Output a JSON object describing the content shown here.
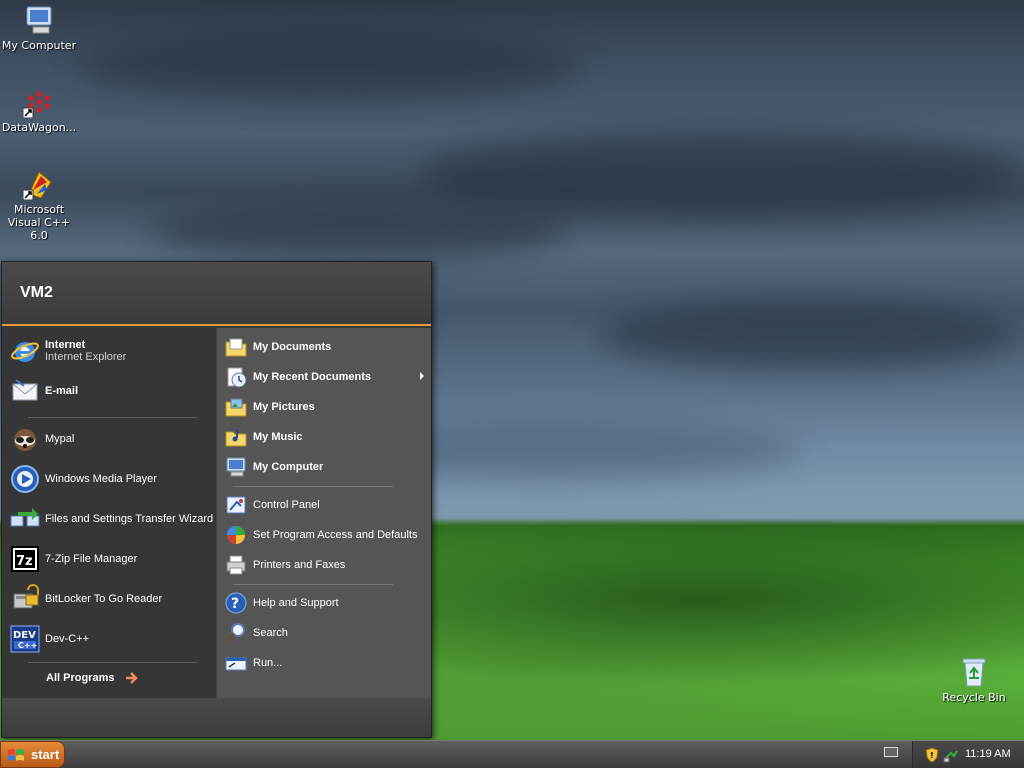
{
  "desktop": {
    "icons": [
      {
        "label": "My Computer"
      },
      {
        "label": "DataWagon..."
      },
      {
        "label": "Microsoft Visual C++ 6.0"
      },
      {
        "label": "Recycle Bin"
      }
    ]
  },
  "start_menu": {
    "user_name": "VM2",
    "pinned": [
      {
        "title": "Internet",
        "subtitle": "Internet Explorer",
        "icon": "internet-explorer-icon"
      },
      {
        "title": "E-mail",
        "icon": "email-icon"
      }
    ],
    "recent": [
      {
        "label": "Mypal",
        "icon": "mypal-icon"
      },
      {
        "label": "Windows Media Player",
        "icon": "media-player-icon"
      },
      {
        "label": "Files and Settings Transfer Wizard",
        "icon": "transfer-wizard-icon"
      },
      {
        "label": "7-Zip File Manager",
        "icon": "7zip-icon"
      },
      {
        "label": "BitLocker To Go Reader",
        "icon": "bitlocker-icon"
      },
      {
        "label": "Dev-C++",
        "icon": "devcpp-icon"
      }
    ],
    "all_programs": "All Programs",
    "right": [
      {
        "label": "My Documents",
        "icon": "folder-icon"
      },
      {
        "label": "My Recent Documents",
        "icon": "recent-docs-icon"
      },
      {
        "label": "My Pictures",
        "icon": "pictures-folder-icon"
      },
      {
        "label": "My Music",
        "icon": "music-folder-icon"
      },
      {
        "label": "My Computer",
        "icon": "computer-icon"
      },
      {
        "label": "Control Panel",
        "icon": "control-panel-icon"
      },
      {
        "label": "Set Program Access and Defaults",
        "icon": "program-defaults-icon"
      },
      {
        "label": "Printers and Faxes",
        "icon": "printer-icon"
      },
      {
        "label": "Help and Support",
        "icon": "help-icon"
      },
      {
        "label": "Search",
        "icon": "search-icon"
      },
      {
        "label": "Run...",
        "icon": "run-icon"
      }
    ]
  },
  "taskbar": {
    "start_label": "start",
    "clock": "11:19 AM"
  },
  "colors": {
    "accent": "#e29a3a",
    "start_button": "#d2732a"
  }
}
